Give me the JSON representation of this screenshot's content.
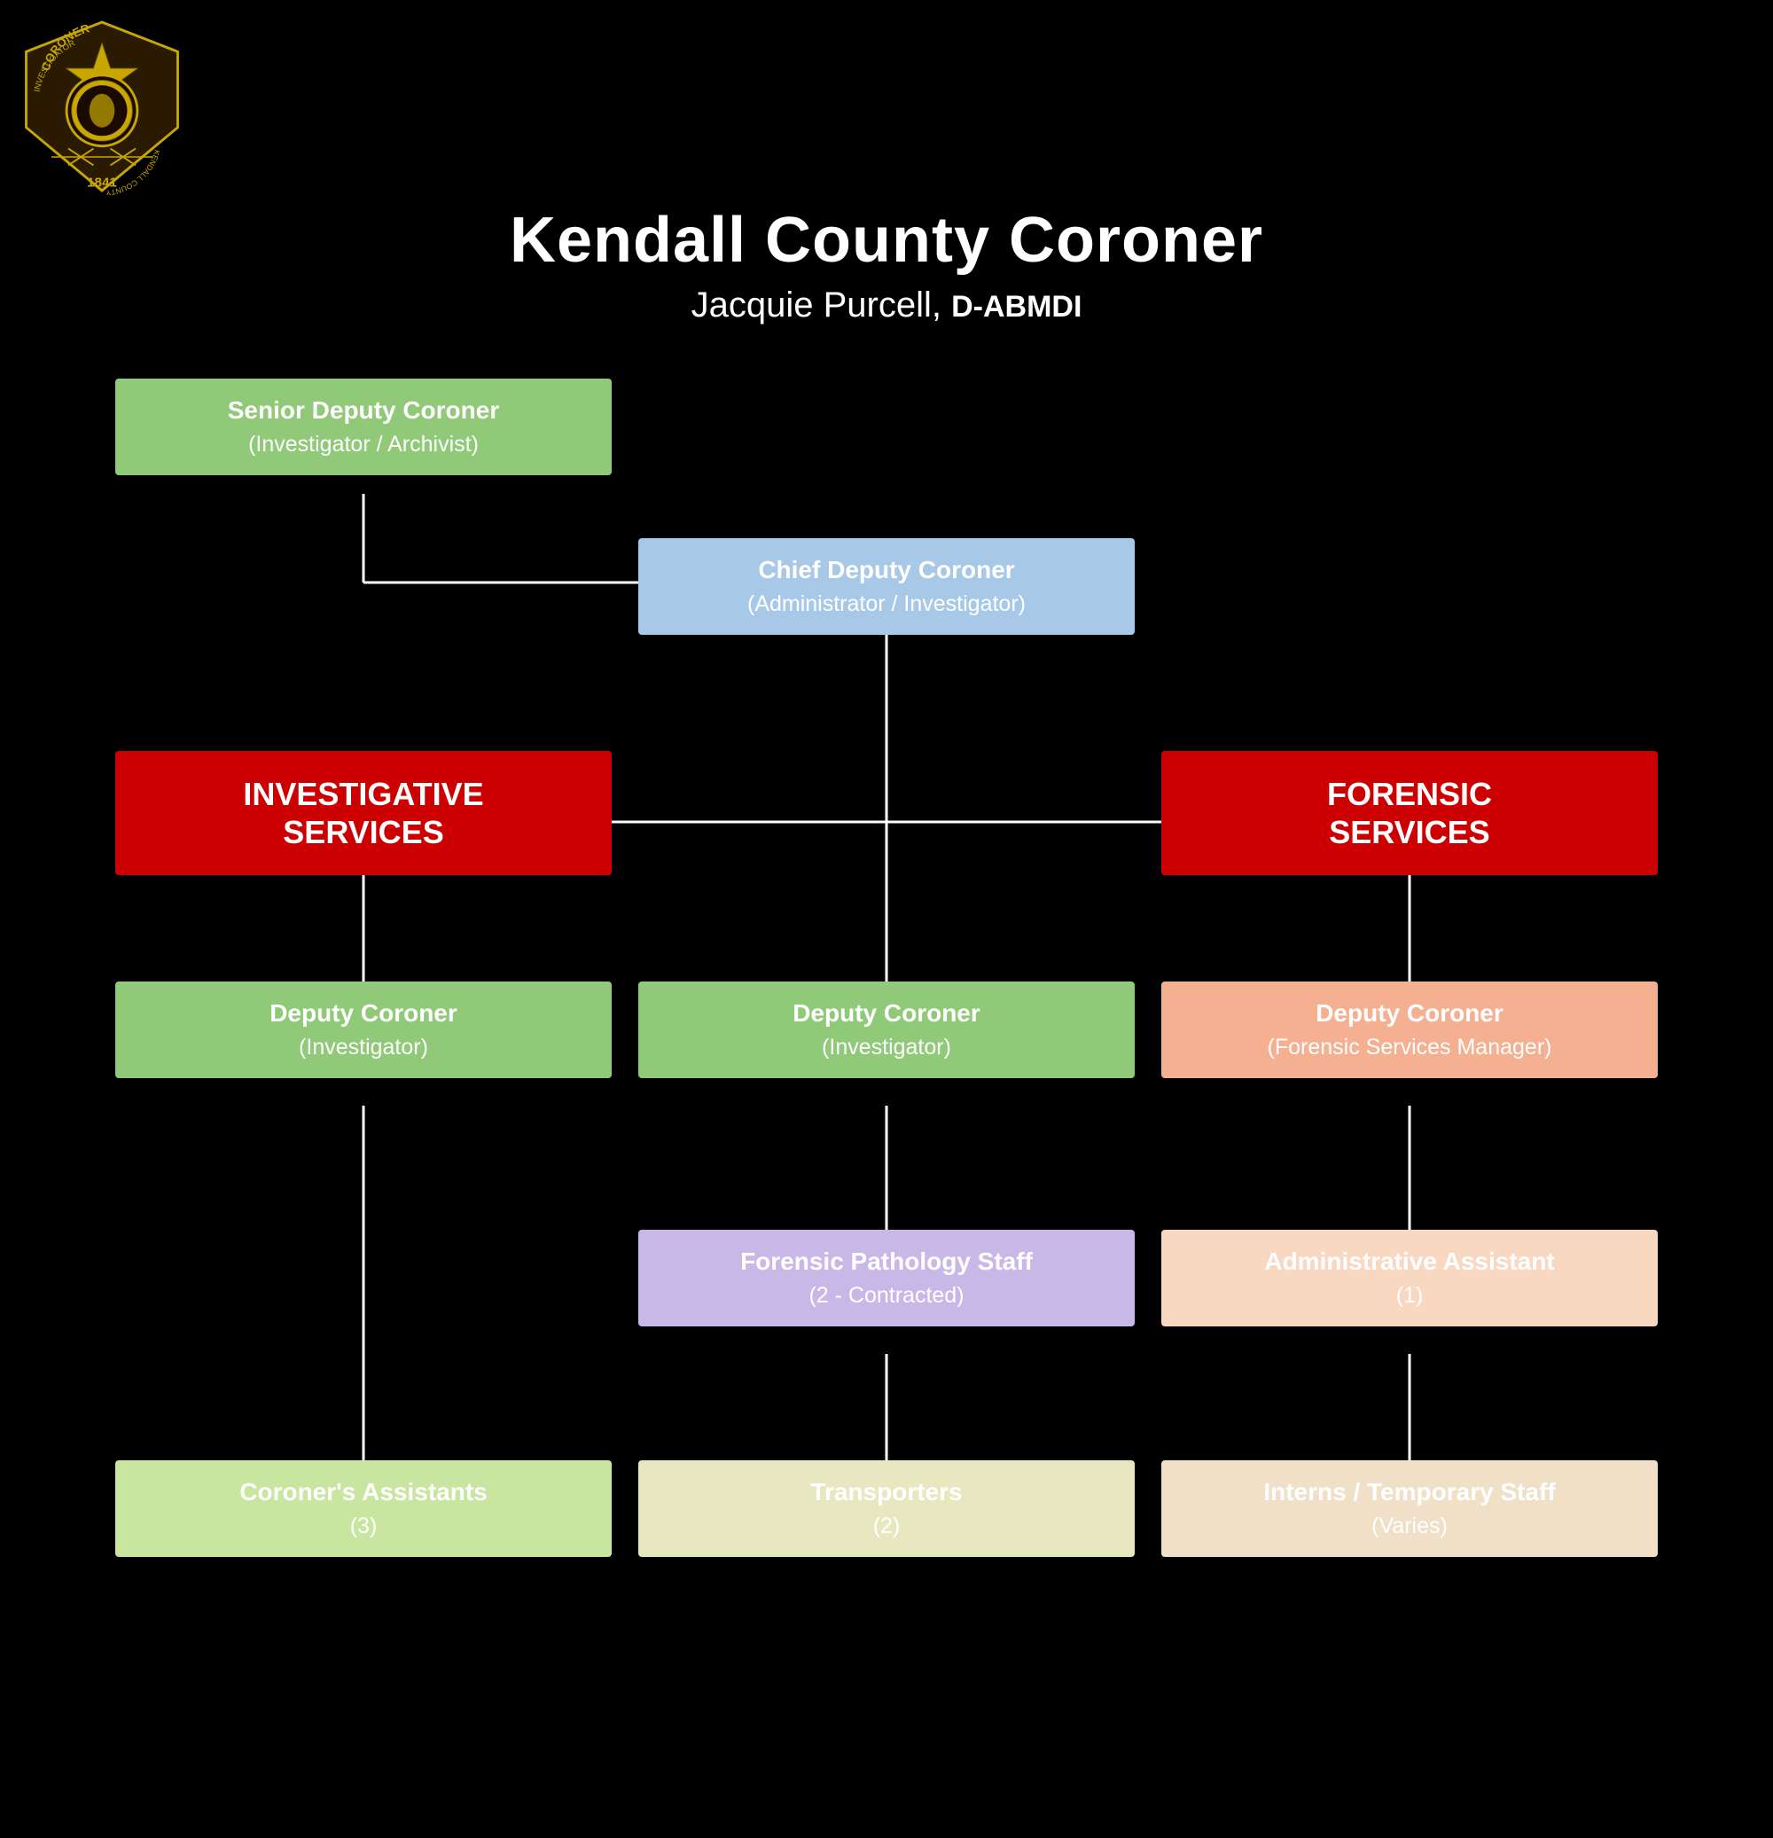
{
  "logo": {
    "alt": "Coroner Investigator Badge",
    "year": "1841"
  },
  "header": {
    "title": "Kendall County Coroner",
    "subtitle_name": "Jacquie Purcell,",
    "subtitle_credential": "D-ABMDI"
  },
  "boxes": {
    "senior_deputy": {
      "title": "Senior Deputy Coroner",
      "subtitle": "(Investigator / Archivist)",
      "color": "green"
    },
    "chief_deputy": {
      "title": "Chief Deputy Coroner",
      "subtitle": "(Administrator / Investigator)",
      "color": "blue"
    },
    "investigative_services": {
      "title": "INVESTIGATIVE\nSERVICES",
      "color": "red"
    },
    "forensic_services": {
      "title": "FORENSIC\nSERVICES",
      "color": "red"
    },
    "deputy_coroner_left": {
      "title": "Deputy Coroner",
      "subtitle": "(Investigator)",
      "color": "green"
    },
    "deputy_coroner_mid": {
      "title": "Deputy Coroner",
      "subtitle": "(Investigator)",
      "color": "green"
    },
    "deputy_coroner_right": {
      "title": "Deputy Coroner",
      "subtitle": "(Forensic Services Manager)",
      "color": "peach"
    },
    "forensic_pathology": {
      "title": "Forensic Pathology Staff",
      "subtitle": "(2 - Contracted)",
      "color": "lavender"
    },
    "admin_assistant": {
      "title": "Administrative Assistant",
      "subtitle": "(1)",
      "color": "light_peach"
    },
    "coroners_assistants": {
      "title": "Coroner's Assistants",
      "subtitle": "(3)",
      "color": "light_green"
    },
    "transporters": {
      "title": "Transporters",
      "subtitle": "(2)",
      "color": "cream"
    },
    "interns": {
      "title": "Interns / Temporary Staff",
      "subtitle": "(Varies)",
      "color": "light_tan"
    }
  }
}
